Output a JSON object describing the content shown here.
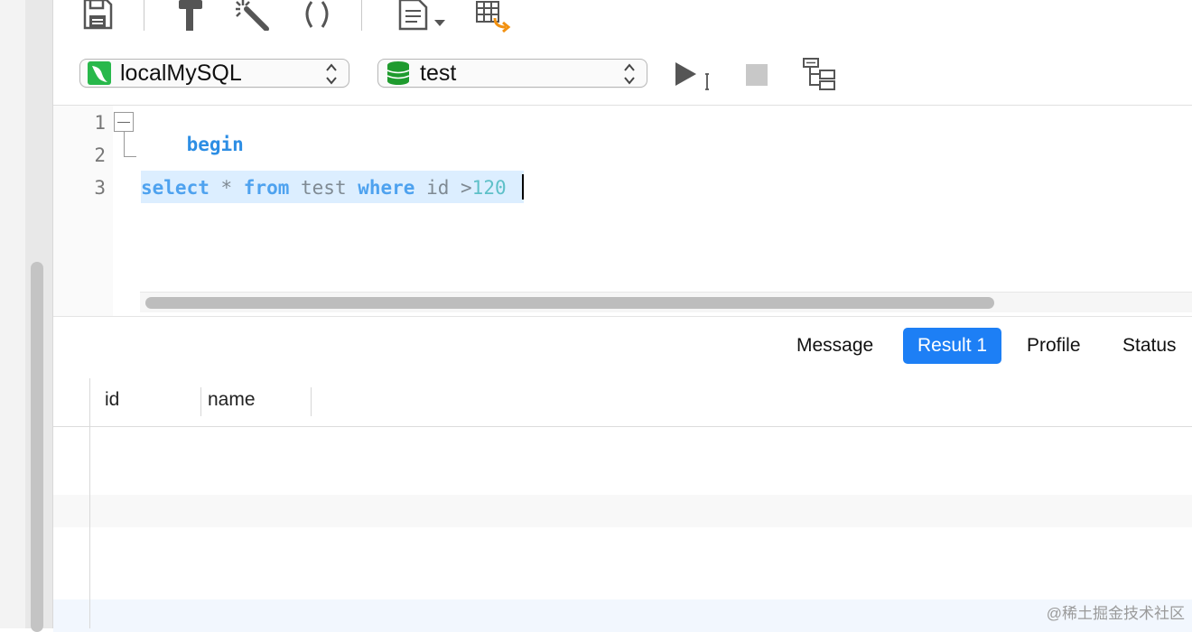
{
  "toolbar": {
    "icons": [
      "save-icon",
      "hammer-icon",
      "magic-wand-icon",
      "parentheses-icon",
      "document-icon",
      "table-export-icon"
    ],
    "connection_select": {
      "value": "localMySQL",
      "icon": "mysql-dolphin-icon"
    },
    "database_select": {
      "value": "test",
      "icon": "database-icon"
    },
    "run_icon": "run-icon",
    "stop_icon": "stop-icon",
    "explain_icon": "explain-tree-icon"
  },
  "editor": {
    "line_numbers": [
      "1",
      "2",
      "3"
    ],
    "line1_keyword": "begin",
    "line3": {
      "kw_select": "select",
      "star": " * ",
      "kw_from": "from",
      "table": " test ",
      "kw_where": "where",
      "cond": " id >",
      "number": "120"
    }
  },
  "tabs": [
    {
      "label": "Message",
      "active": false
    },
    {
      "label": "Result 1",
      "active": true
    },
    {
      "label": "Profile",
      "active": false
    },
    {
      "label": "Status",
      "active": false
    }
  ],
  "grid": {
    "columns": [
      "id",
      "name"
    ]
  },
  "watermark": "@稀土掘金技术社区",
  "colors": {
    "accent": "#1d7ff5",
    "keyword": "#2d8ee4",
    "selection": "#dceeff"
  }
}
